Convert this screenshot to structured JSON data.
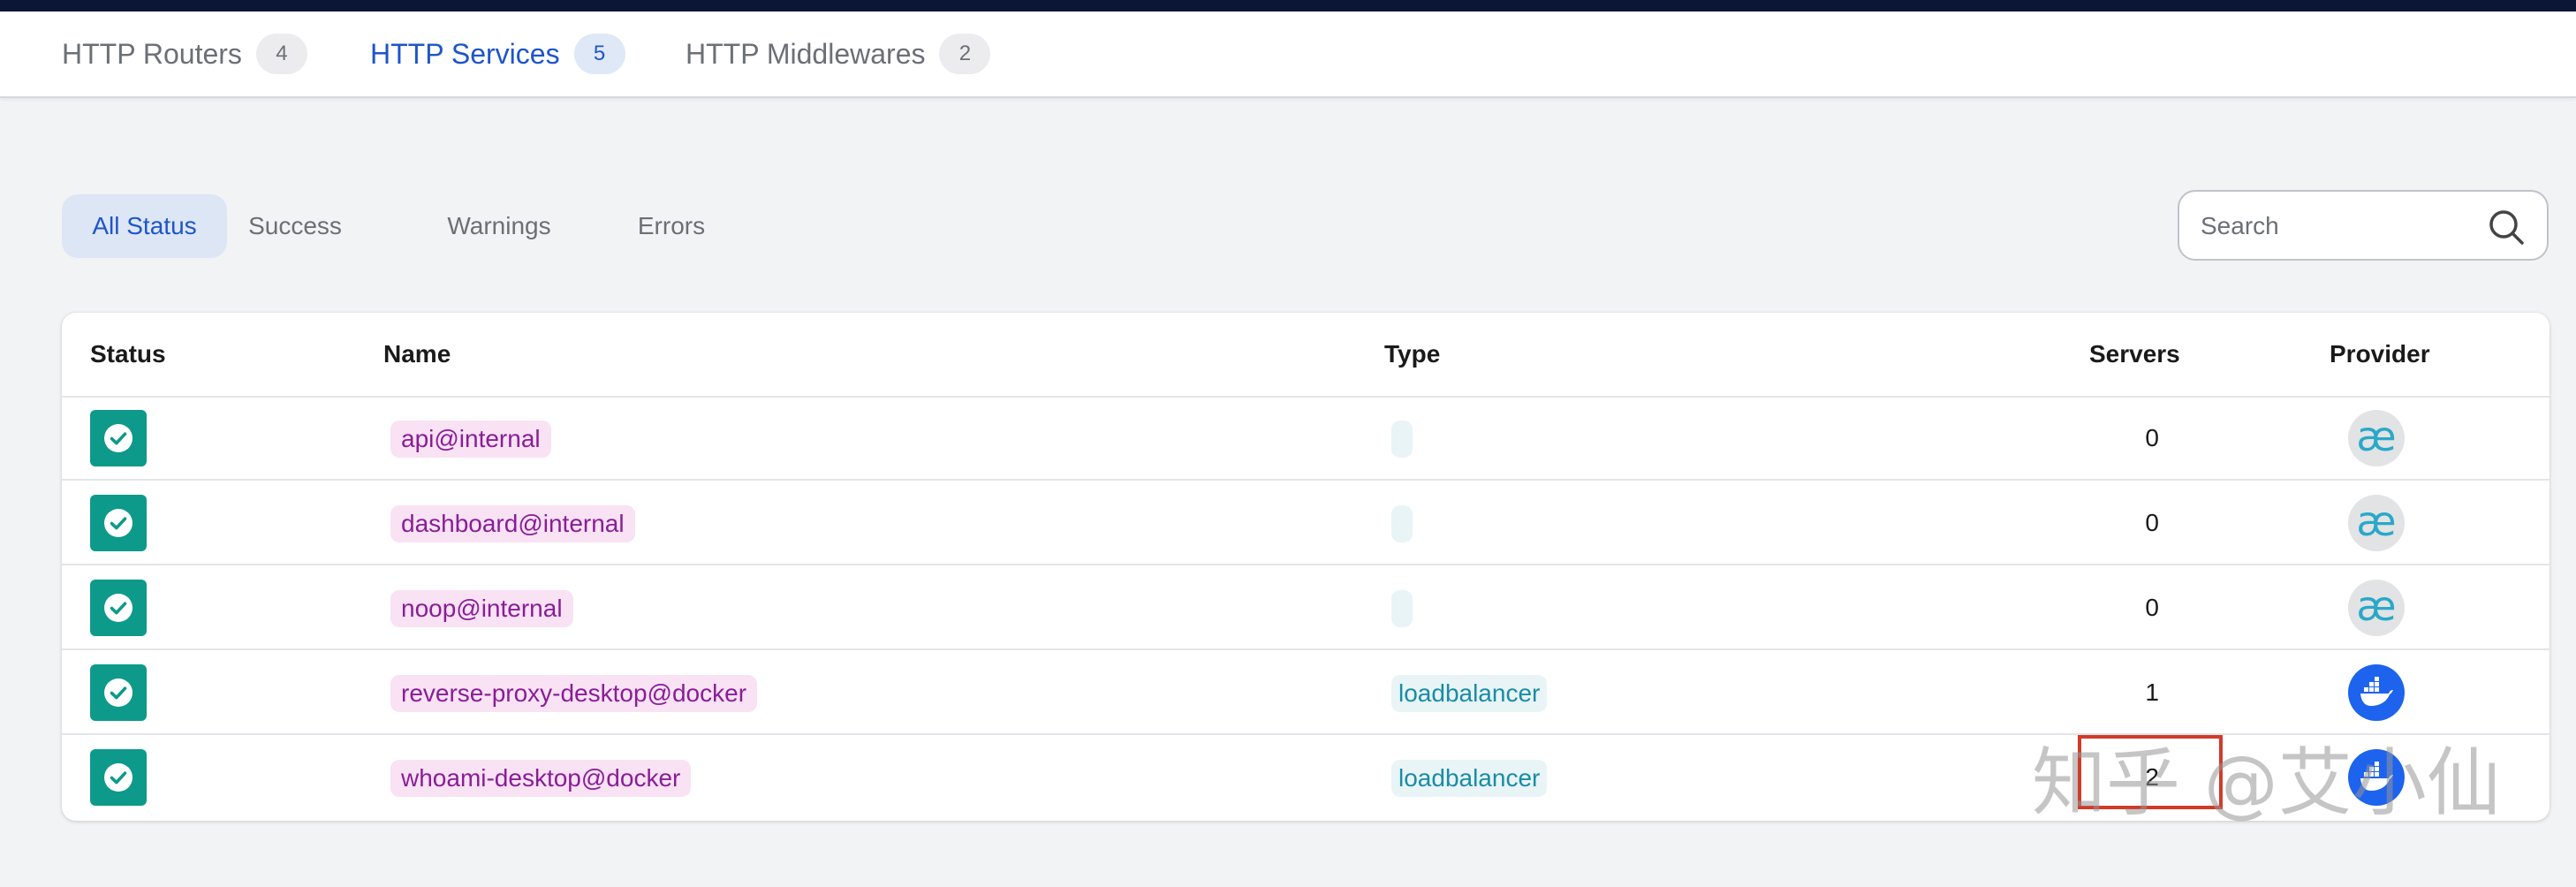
{
  "tabs": [
    {
      "label": "HTTP Routers",
      "count": "4"
    },
    {
      "label": "HTTP Services",
      "count": "5",
      "active": true
    },
    {
      "label": "HTTP Middlewares",
      "count": "2"
    }
  ],
  "filters": [
    {
      "label": "All Status",
      "active": true
    },
    {
      "label": "Success"
    },
    {
      "label": "Warnings"
    },
    {
      "label": "Errors"
    }
  ],
  "search": {
    "placeholder": "Search",
    "icon": "search-icon"
  },
  "table": {
    "headers": {
      "status": "Status",
      "name": "Name",
      "type": "Type",
      "servers": "Servers",
      "provider": "Provider"
    },
    "rows": [
      {
        "status": "success",
        "name": "api@internal",
        "type": "",
        "servers": "0",
        "provider": "internal"
      },
      {
        "status": "success",
        "name": "dashboard@internal",
        "type": "",
        "servers": "0",
        "provider": "internal"
      },
      {
        "status": "success",
        "name": "noop@internal",
        "type": "",
        "servers": "0",
        "provider": "internal"
      },
      {
        "status": "success",
        "name": "reverse-proxy-desktop@docker",
        "type": "loadbalancer",
        "servers": "1",
        "provider": "docker"
      },
      {
        "status": "success",
        "name": "whoami-desktop@docker",
        "type": "loadbalancer",
        "servers": "2",
        "provider": "docker"
      }
    ]
  },
  "watermark": "知乎 @艾小仙",
  "colors": {
    "accent": "#1e55c9",
    "success": "#0d9a8a",
    "name_chip_bg": "#f8e2f3",
    "name_chip_text": "#8a1d98",
    "type_chip_bg": "#e8f4f6",
    "type_chip_text": "#1a8ca5",
    "docker": "#1d63ed",
    "highlight_box": "#d23a2a"
  }
}
